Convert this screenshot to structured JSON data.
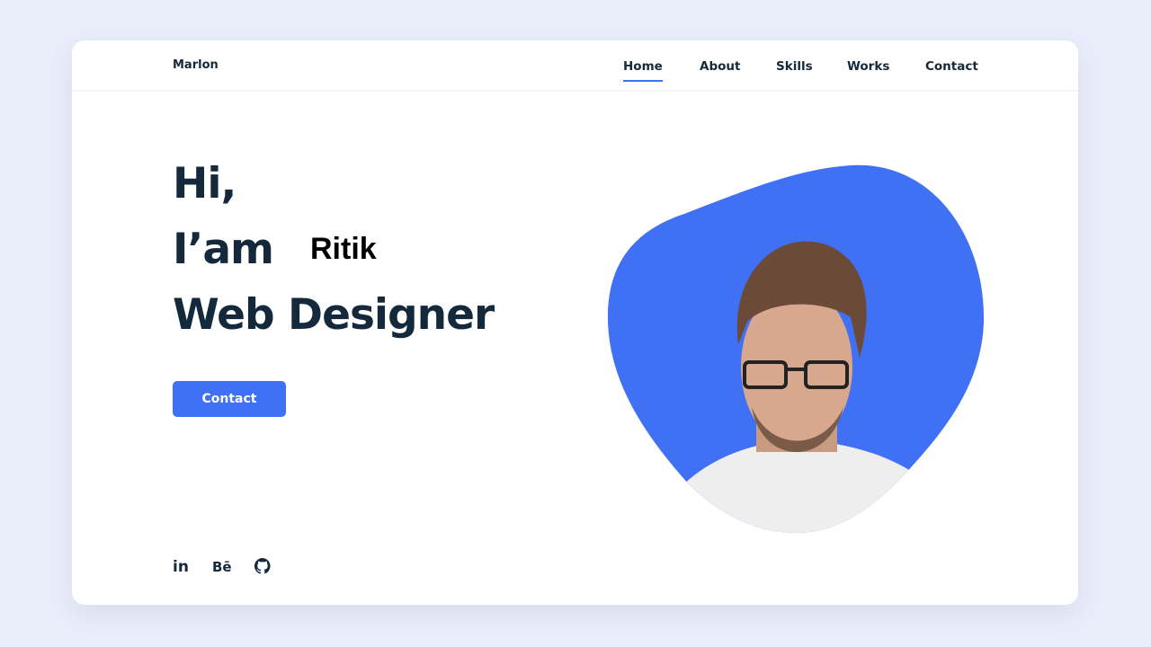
{
  "header": {
    "logo": "Marlon",
    "nav": [
      {
        "label": "Home",
        "active": true
      },
      {
        "label": "About"
      },
      {
        "label": "Skills"
      },
      {
        "label": "Works"
      },
      {
        "label": "Contact"
      }
    ]
  },
  "hero": {
    "line1": "Hi,",
    "line2": "I’am",
    "name": "Ritik",
    "line3": "Web Designer",
    "button": "Contact"
  },
  "social": [
    {
      "icon": "linkedin-icon",
      "label": "in"
    },
    {
      "icon": "behance-icon",
      "label": "Bē"
    },
    {
      "icon": "github-icon"
    }
  ],
  "colors": {
    "accent": "#4070f4",
    "text": "#14293b",
    "background": "#e9eefb"
  }
}
